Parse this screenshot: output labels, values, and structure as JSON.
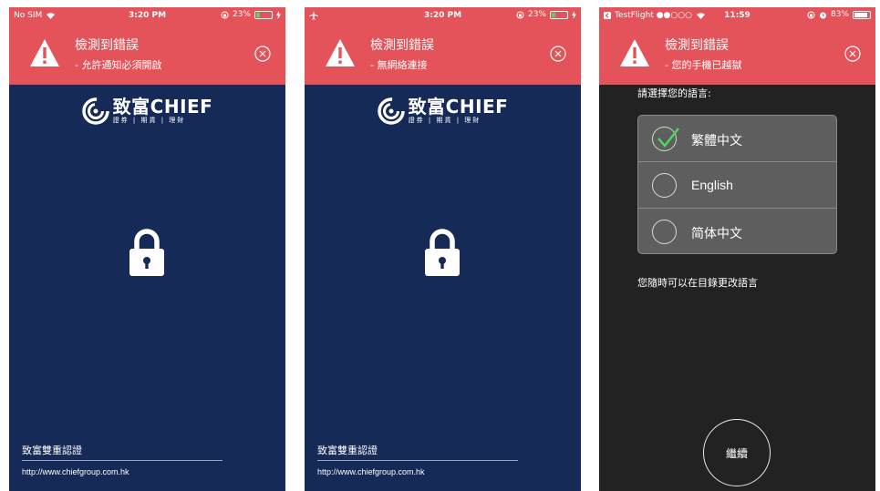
{
  "screens": [
    {
      "status": {
        "left": "No SIM",
        "time": "3:20 PM",
        "battery": "23%"
      },
      "alert": {
        "title": "檢測到錯誤",
        "message": "- 允許通知必須開啟"
      },
      "logo": {
        "name": "致富CHIEF",
        "subtitle": "證券 | 期貨 | 理財"
      },
      "footer": {
        "title": "致富雙重認證",
        "url": "http://www.chiefgroup.com.hk"
      }
    },
    {
      "status": {
        "left": "",
        "time": "3:20 PM",
        "battery": "23%"
      },
      "alert": {
        "title": "檢測到錯誤",
        "message": "- 無網絡連接"
      },
      "logo": {
        "name": "致富CHIEF",
        "subtitle": "證券 | 期貨 | 理財"
      },
      "footer": {
        "title": "致富雙重認證",
        "url": "http://www.chiefgroup.com.hk"
      }
    },
    {
      "status": {
        "left": "TestFlight ●●○○○",
        "time": "11:59",
        "battery": "83%"
      },
      "alert": {
        "title": "檢測到錯誤",
        "message": "- 您的手機已越獄"
      },
      "language": {
        "prompt": "請選擇您的語言:",
        "options": [
          {
            "label": "繁體中文",
            "selected": true
          },
          {
            "label": "English",
            "selected": false
          },
          {
            "label": "简体中文",
            "selected": false
          }
        ],
        "note": "您隨時可以在目錄更改語言",
        "continue": "繼續"
      }
    }
  ],
  "battery_levels": [
    0.23,
    0.23,
    0.83
  ],
  "colors": {
    "alert": "#e4535a",
    "brand_bg": "#162a58",
    "dark_bg": "#222222",
    "check": "#4cd964"
  },
  "icons": [
    "wifi-icon",
    "airplane-icon",
    "alarm-icon",
    "warning-icon",
    "close-circle-icon",
    "chief-logo-icon",
    "padlock-icon",
    "checkmark-icon"
  ]
}
